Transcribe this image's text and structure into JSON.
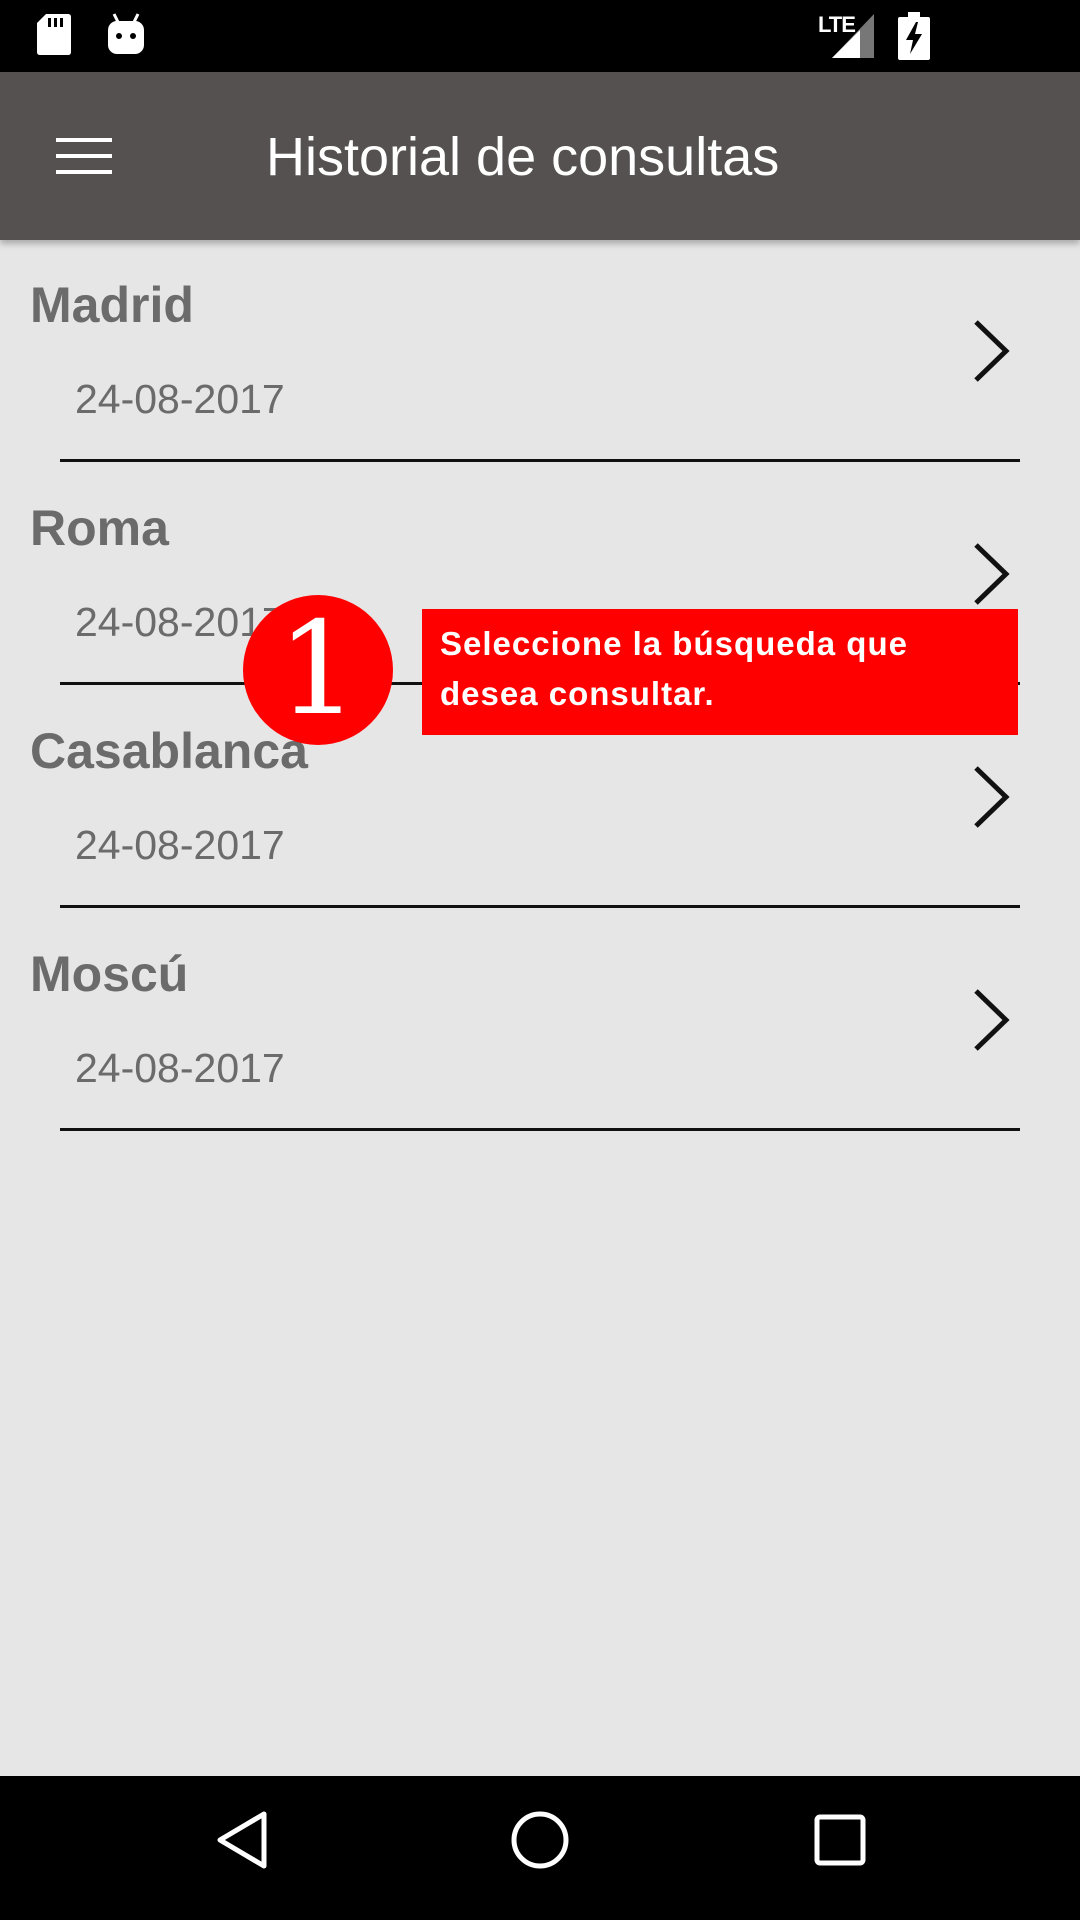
{
  "status_bar": {
    "left_icons": [
      "sd-card-icon",
      "android-icon"
    ],
    "network_label": "LTE",
    "right_icons": [
      "signal-icon",
      "battery-charging-icon"
    ]
  },
  "app_bar": {
    "menu_icon": "hamburger-menu-icon",
    "title": "Historial de consultas",
    "background": "#545150"
  },
  "history": {
    "items": [
      {
        "city": "Madrid",
        "date": "24-08-2017",
        "icon": "chevron-right-icon"
      },
      {
        "city": "Roma",
        "date": "24-08-2017",
        "icon": "chevron-right-icon"
      },
      {
        "city": "Casablanca",
        "date": "24-08-2017",
        "icon": "chevron-right-icon"
      },
      {
        "city": "Moscú",
        "date": "24-08-2017",
        "icon": "chevron-right-icon"
      }
    ]
  },
  "callout": {
    "number": "1",
    "text": "Seleccione la búsqueda que desea consultar.",
    "color": "#ff0000"
  },
  "nav_bar": {
    "buttons": [
      "back-icon",
      "home-icon",
      "recents-icon"
    ]
  }
}
